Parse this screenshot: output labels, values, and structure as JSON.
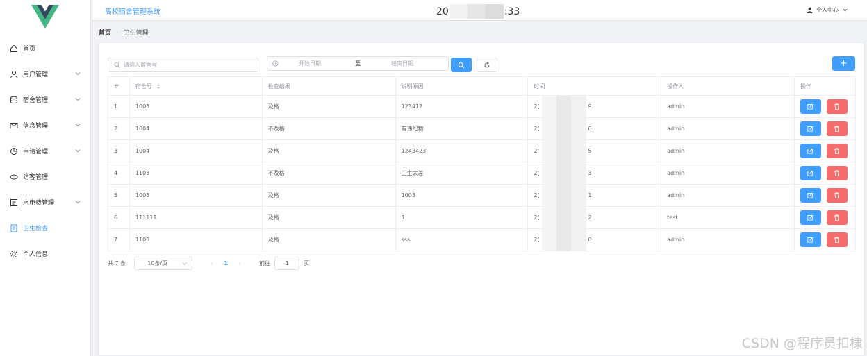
{
  "app": {
    "title": "高校宿舍管理系统"
  },
  "clock": {
    "prefix": "20",
    "suffix": ":33"
  },
  "user_menu": {
    "label": "个人中心"
  },
  "breadcrumb": {
    "home": "首页",
    "current": "卫生管理"
  },
  "sidebar": {
    "items": [
      {
        "label": "首页",
        "icon": "home-icon"
      },
      {
        "label": "用户管理",
        "icon": "user-icon"
      },
      {
        "label": "宿舍管理",
        "icon": "database-icon"
      },
      {
        "label": "信息管理",
        "icon": "message-icon"
      },
      {
        "label": "申请管理",
        "icon": "pie-chart-icon"
      },
      {
        "label": "访客管理",
        "icon": "eye-icon"
      },
      {
        "label": "水电费管理",
        "icon": "document-icon"
      },
      {
        "label": "卫生检查",
        "icon": "notebook-icon"
      },
      {
        "label": "个人信息",
        "icon": "gear-icon"
      }
    ]
  },
  "search": {
    "placeholder": "请输入宿舍号"
  },
  "date_range": {
    "start_placeholder": "开始日期",
    "separator": "至",
    "end_placeholder": "结束日期"
  },
  "add_label": "+",
  "table": {
    "headers": [
      "#",
      "宿舍号",
      "检查结果",
      "说明原因",
      "时间",
      "操作人",
      "操作"
    ],
    "rows": [
      {
        "index": "1",
        "room": "1003",
        "result": "及格",
        "reason": "123412",
        "time_prefix": "2(",
        "time_suffix": "9",
        "operator": "admin"
      },
      {
        "index": "2",
        "room": "1004",
        "result": "不及格",
        "reason": "有违纪物",
        "time_prefix": "2(",
        "time_suffix": "6",
        "operator": "admin"
      },
      {
        "index": "3",
        "room": "1004",
        "result": "及格",
        "reason": "1243423",
        "time_prefix": "2(",
        "time_suffix": "5",
        "operator": "admin"
      },
      {
        "index": "4",
        "room": "1103",
        "result": "不及格",
        "reason": "卫生太差",
        "time_prefix": "2(",
        "time_suffix": "3",
        "operator": "admin"
      },
      {
        "index": "5",
        "room": "1003",
        "result": "及格",
        "reason": "1003",
        "time_prefix": "2(",
        "time_suffix": "1",
        "operator": "admin"
      },
      {
        "index": "6",
        "room": "111111",
        "result": "及格",
        "reason": "1",
        "time_prefix": "2(",
        "time_suffix": "2",
        "operator": "test"
      },
      {
        "index": "7",
        "room": "1103",
        "result": "及格",
        "reason": "sss",
        "time_prefix": "2(",
        "time_suffix": "0",
        "operator": "admin"
      }
    ]
  },
  "pagination": {
    "total": "共 7 条",
    "page_size": "10条/页",
    "current_page": "1",
    "prev": "‹",
    "next": "›",
    "goto_label": "前往",
    "goto_value": "1",
    "page_unit": "页"
  },
  "watermark": "CSDN @程序员扣棣",
  "colors": {
    "primary": "#409eff",
    "danger": "#f56c6c",
    "logo_green": "#41b883",
    "logo_dark": "#34495e"
  }
}
